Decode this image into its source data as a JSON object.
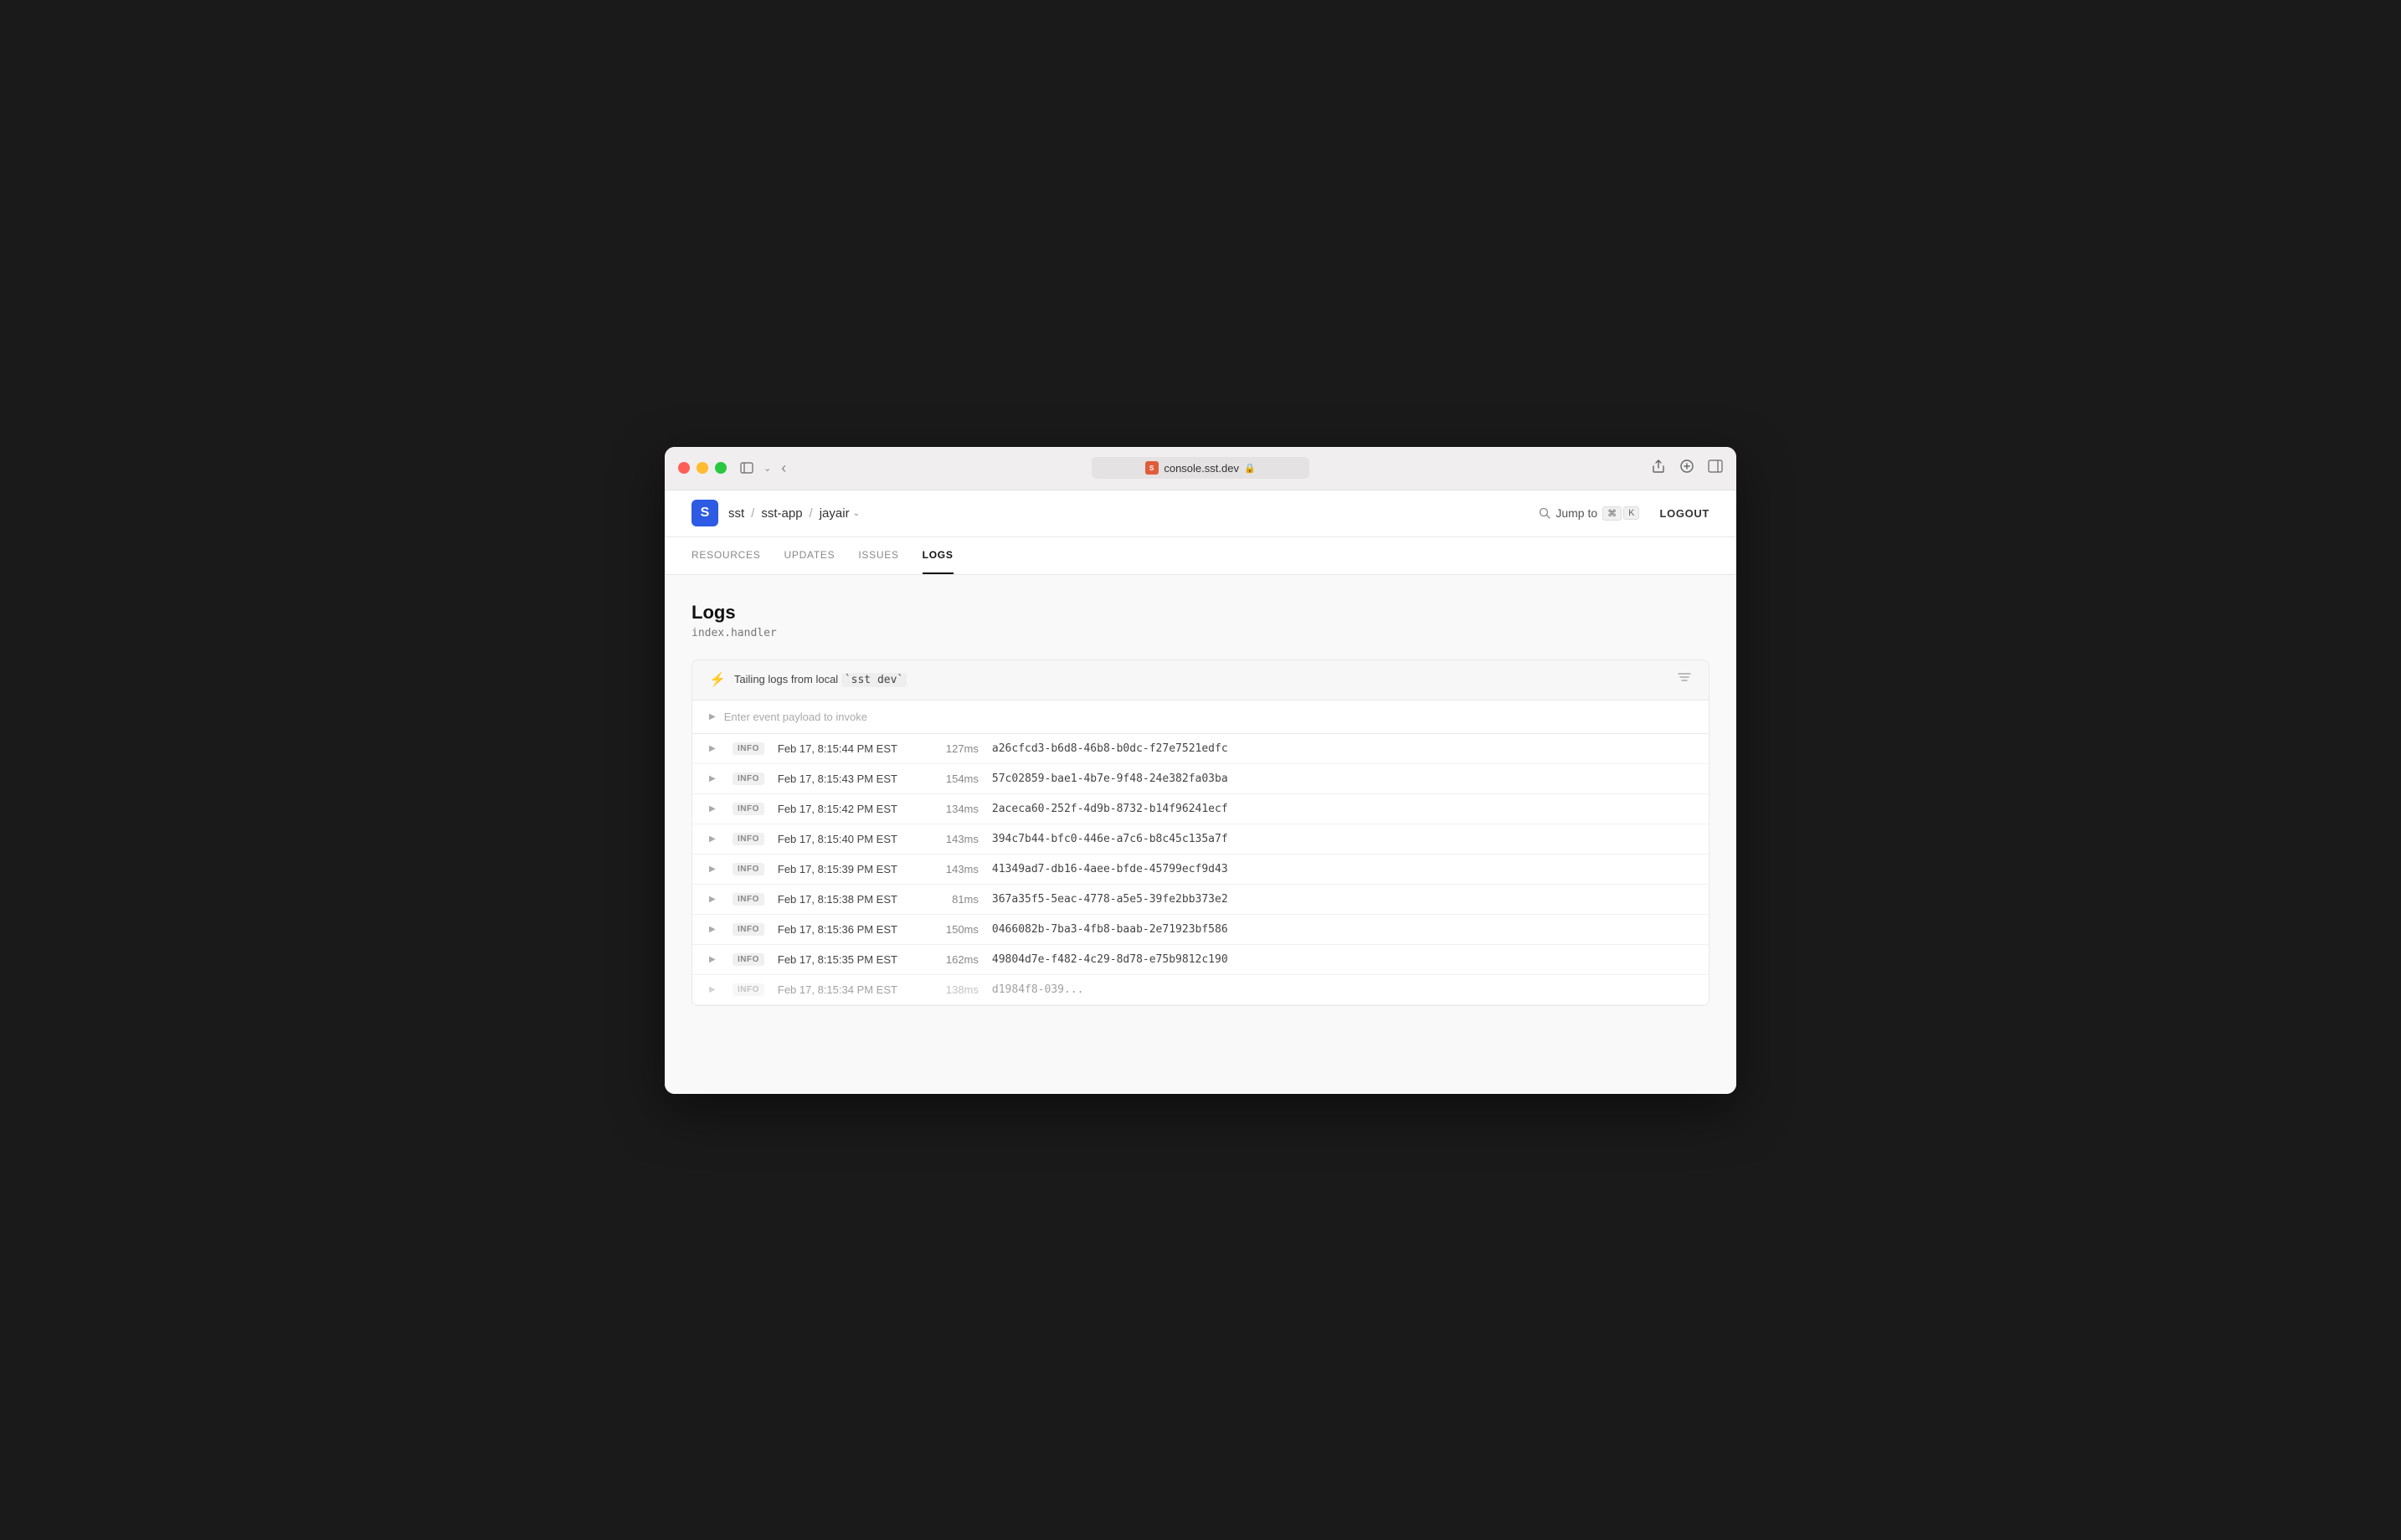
{
  "window": {
    "title": "console.sst.dev"
  },
  "titlebar": {
    "back_icon": "‹",
    "sidebar_icon": "⊞",
    "chevron_icon": "⌄",
    "share_label": "share",
    "new_tab_label": "new-tab",
    "sidebar_right_label": "sidebar-right"
  },
  "addressbar": {
    "favicon_text": "S",
    "url": "console.sst.dev",
    "lock_icon": "🔒"
  },
  "appbar": {
    "logo_letter": "S",
    "breadcrumb": [
      {
        "label": "sst",
        "id": "bc-sst"
      },
      {
        "label": "sst-app",
        "id": "bc-sst-app"
      },
      {
        "label": "jayair",
        "id": "bc-jayair"
      }
    ],
    "jump_to_label": "Jump to",
    "kbd_cmd": "⌘",
    "kbd_key": "K",
    "logout_label": "LOGOUT"
  },
  "nav": {
    "tabs": [
      {
        "label": "RESOURCES",
        "active": false
      },
      {
        "label": "UPDATES",
        "active": false
      },
      {
        "label": "ISSUES",
        "active": false
      },
      {
        "label": "LOGS",
        "active": true
      }
    ]
  },
  "page": {
    "title": "Logs",
    "subtitle": "index.handler"
  },
  "log_status": {
    "text_prefix": "Tailing logs from local ",
    "command": "`sst dev`"
  },
  "event_payload": {
    "placeholder": "Enter event payload to invoke"
  },
  "log_rows": [
    {
      "level": "INFO",
      "timestamp": "Feb 17, 8:15:44 PM EST",
      "duration": "127ms",
      "id": "a26cfcd3-b6d8-46b8-b0dc-f27e7521edfc"
    },
    {
      "level": "INFO",
      "timestamp": "Feb 17, 8:15:43 PM EST",
      "duration": "154ms",
      "id": "57c02859-bae1-4b7e-9f48-24e382fa03ba"
    },
    {
      "level": "INFO",
      "timestamp": "Feb 17, 8:15:42 PM EST",
      "duration": "134ms",
      "id": "2aceca60-252f-4d9b-8732-b14f96241ecf"
    },
    {
      "level": "INFO",
      "timestamp": "Feb 17, 8:15:40 PM EST",
      "duration": "143ms",
      "id": "394c7b44-bfc0-446e-a7c6-b8c45c135a7f"
    },
    {
      "level": "INFO",
      "timestamp": "Feb 17, 8:15:39 PM EST",
      "duration": "143ms",
      "id": "41349ad7-db16-4aee-bfde-45799ecf9d43"
    },
    {
      "level": "INFO",
      "timestamp": "Feb 17, 8:15:38 PM EST",
      "duration": "81ms",
      "id": "367a35f5-5eac-4778-a5e5-39fe2bb373e2"
    },
    {
      "level": "INFO",
      "timestamp": "Feb 17, 8:15:36 PM EST",
      "duration": "150ms",
      "id": "0466082b-7ba3-4fb8-baab-2e71923bf586"
    },
    {
      "level": "INFO",
      "timestamp": "Feb 17, 8:15:35 PM EST",
      "duration": "162ms",
      "id": "49804d7e-f482-4c29-8d78-e75b9812c190"
    },
    {
      "level": "INFO",
      "timestamp": "Feb 17, 8:15:34 PM EST",
      "duration": "138ms",
      "id": "d1984f8-039..."
    }
  ]
}
